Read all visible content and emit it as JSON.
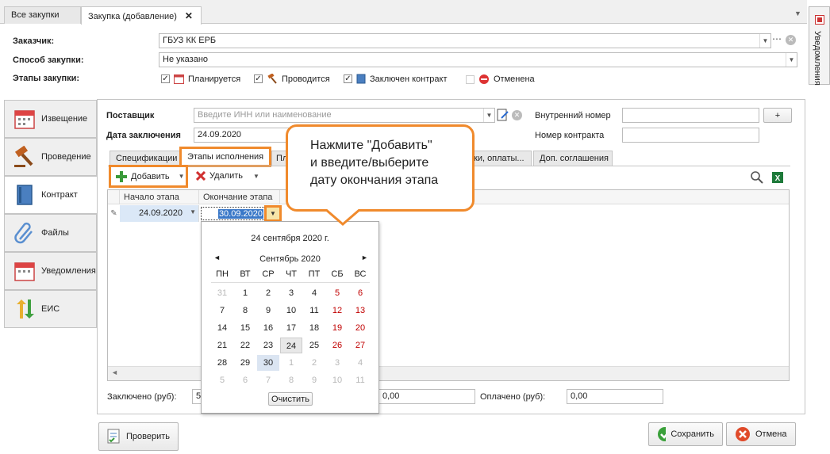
{
  "tabs": [
    {
      "label": "Все закупки"
    },
    {
      "label": "Закупка (добавление)",
      "close": "✕"
    }
  ],
  "side_panel": {
    "label": "Уведомления"
  },
  "header": {
    "customer_label": "Заказчик:",
    "customer_value": "ГБУЗ КК ЕРБ",
    "method_label": "Способ закупки:",
    "method_value": "Не указано",
    "stages_label": "Этапы закупки:",
    "stages": [
      {
        "label": "Планируется",
        "checked": true
      },
      {
        "label": "Проводится",
        "checked": true
      },
      {
        "label": "Заключен контракт",
        "checked": true
      },
      {
        "label": "Отменена",
        "checked": false
      }
    ]
  },
  "nav": [
    {
      "label": "Извещение"
    },
    {
      "label": "Проведение"
    },
    {
      "label": "Контракт"
    },
    {
      "label": "Файлы"
    },
    {
      "label": "Уведомления"
    },
    {
      "label": "ЕИС"
    }
  ],
  "contract": {
    "supplier_label": "Поставщик",
    "supplier_placeholder": "Введите ИНН или наименование",
    "date_label": "Дата заключения",
    "date_value": "24.09.2020",
    "internal_label": "Внутренний номер",
    "contract_no_label": "Номер контракта",
    "plus": "+"
  },
  "subtabs": [
    "Спецификации",
    "Этапы исполнения",
    "Пл",
    "ки, оплаты...",
    "Доп. соглашения"
  ],
  "toolbar": {
    "add": "Добавить",
    "delete": "Удалить"
  },
  "grid": {
    "col_start": "Начало этапа",
    "col_end": "Окончание этапа",
    "row_start": "24.09.2020",
    "row_end": "30.09.2020"
  },
  "calendar": {
    "today_label": "24 сентября 2020 г.",
    "month_label": "Сентябрь 2020",
    "weekdays": [
      "ПН",
      "ВТ",
      "СР",
      "ЧТ",
      "ПТ",
      "СБ",
      "ВС"
    ],
    "weeks": [
      [
        "31",
        "1",
        "2",
        "3",
        "4",
        "5",
        "6"
      ],
      [
        "7",
        "8",
        "9",
        "10",
        "11",
        "12",
        "13"
      ],
      [
        "14",
        "15",
        "16",
        "17",
        "18",
        "19",
        "20"
      ],
      [
        "21",
        "22",
        "23",
        "24",
        "25",
        "26",
        "27"
      ],
      [
        "28",
        "29",
        "30",
        "1",
        "2",
        "3",
        "4"
      ],
      [
        "5",
        "6",
        "7",
        "8",
        "9",
        "10",
        "11"
      ]
    ],
    "clear": "Очистить"
  },
  "callout": {
    "line1": "Нажмите \"Добавить\"",
    "line2": "и введите/выберите",
    "line3": "дату окончания этапа"
  },
  "totals": {
    "concluded_label": "Заключено (руб):",
    "concluded_prefix": "5",
    "middle_value": "0,00",
    "paid_label": "Оплачено (руб):",
    "paid_value": "0,00"
  },
  "footer": {
    "check": "Проверить",
    "save": "Сохранить",
    "cancel": "Отмена"
  },
  "colors": {
    "accent": "#f08a2c",
    "weekend": "#c00000",
    "selection": "#3a78c8"
  }
}
